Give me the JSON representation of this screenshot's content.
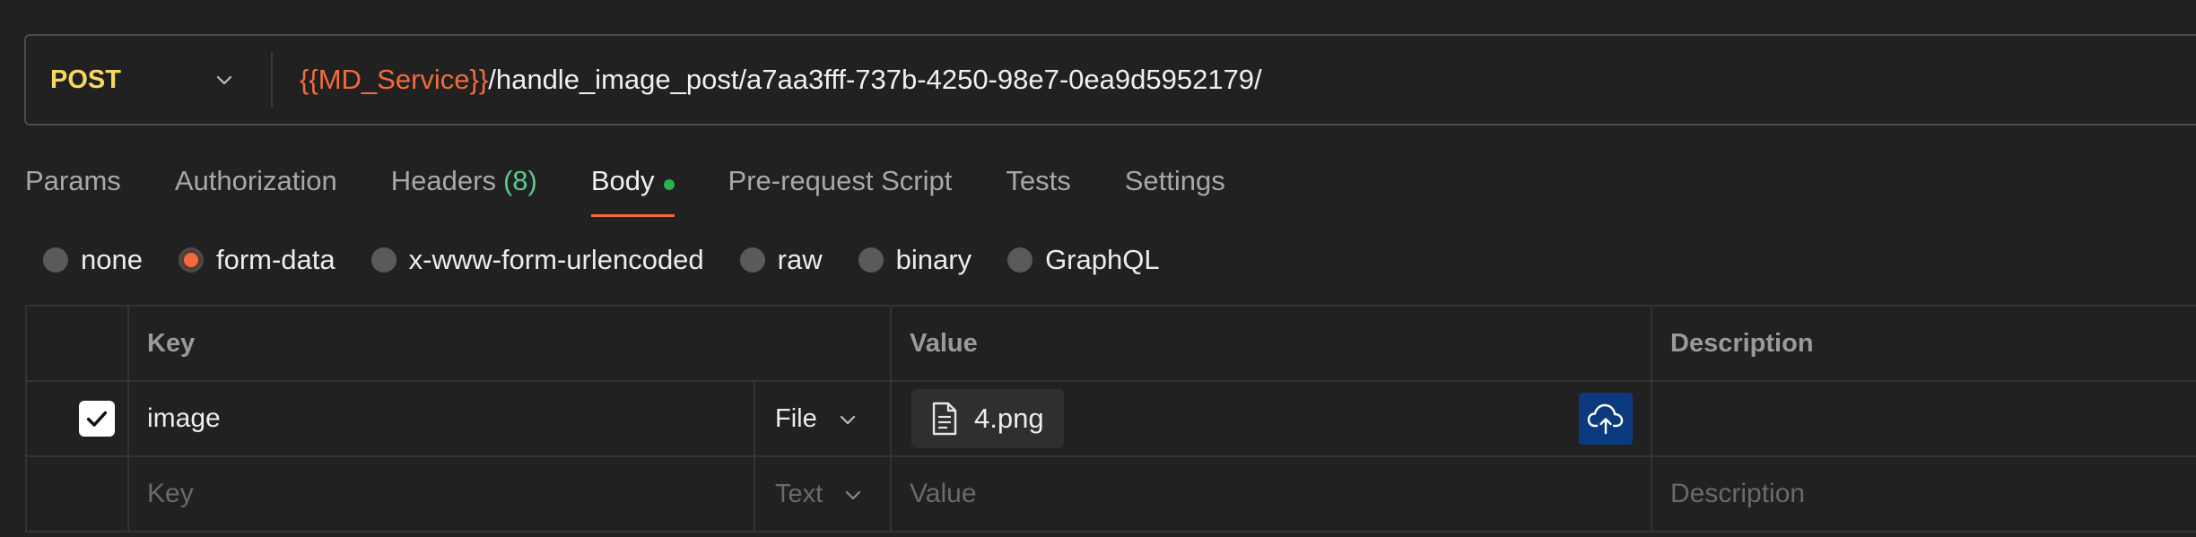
{
  "request": {
    "method": "POST",
    "url_variable": "{{MD_Service}}",
    "url_path": "/handle_image_post/a7aa3fff-737b-4250-98e7-0ea9d5952179/"
  },
  "tabs": [
    {
      "label": "Params"
    },
    {
      "label": "Authorization"
    },
    {
      "label": "Headers",
      "count": "(8)"
    },
    {
      "label": "Body",
      "active": true
    },
    {
      "label": "Pre-request Script"
    },
    {
      "label": "Tests"
    },
    {
      "label": "Settings"
    }
  ],
  "body_types": [
    {
      "label": "none",
      "selected": false
    },
    {
      "label": "form-data",
      "selected": true
    },
    {
      "label": "x-www-form-urlencoded",
      "selected": false
    },
    {
      "label": "raw",
      "selected": false
    },
    {
      "label": "binary",
      "selected": false
    },
    {
      "label": "GraphQL",
      "selected": false
    }
  ],
  "table": {
    "headers": {
      "key": "Key",
      "value": "Value",
      "description": "Description"
    },
    "rows": [
      {
        "checked": true,
        "key": "image",
        "type": "File",
        "value": "4.png",
        "description": ""
      }
    ],
    "placeholder_row": {
      "key": "Key",
      "type": "Text",
      "value": "Value",
      "description": "Description"
    }
  },
  "colors": {
    "method": "#f6d860",
    "accent": "#f26b3a",
    "count": "#5cc98b",
    "body_dot": "#25b34a",
    "upload_button": "#0b3a7e"
  },
  "icons": {
    "method_dropdown": "chevron-down-icon",
    "file": "file-document-icon",
    "upload": "cloud-upload-icon",
    "checkbox": "check-icon"
  }
}
